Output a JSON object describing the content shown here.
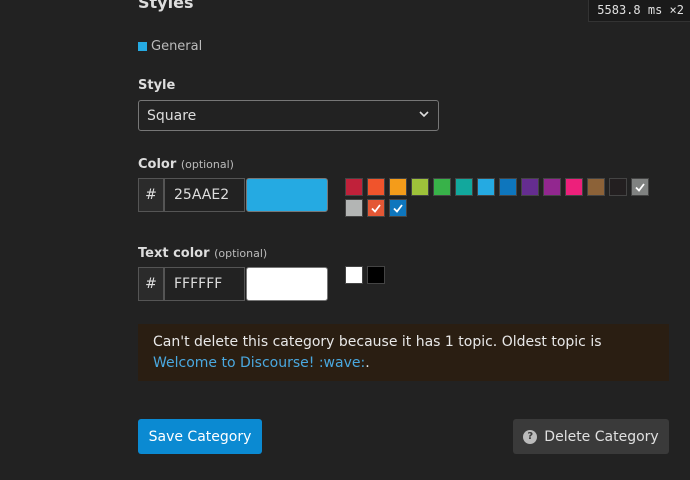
{
  "section_heading": "Styles",
  "timer": {
    "value": "5583.8",
    "unit": "ms",
    "multiplier": "×2"
  },
  "category_badge": {
    "name": "General",
    "color": "#25aae2"
  },
  "style": {
    "label": "Style",
    "selected": "Square"
  },
  "color": {
    "label": "Color",
    "optional": "(optional)",
    "hash": "#",
    "hex_value": "25AAE2",
    "preview_color": "#25aae2",
    "swatches": [
      {
        "color": "#c0213a",
        "checked": false
      },
      {
        "color": "#f0542c",
        "checked": false
      },
      {
        "color": "#f49c1a",
        "checked": false
      },
      {
        "color": "#9ec23a",
        "checked": false
      },
      {
        "color": "#38b249",
        "checked": false
      },
      {
        "color": "#12a89d",
        "checked": false
      },
      {
        "color": "#25aae2",
        "checked": false
      },
      {
        "color": "#0e76bd",
        "checked": false
      },
      {
        "color": "#652d90",
        "checked": false
      },
      {
        "color": "#92278f",
        "checked": false
      },
      {
        "color": "#ed207b",
        "checked": false
      },
      {
        "color": "#8c6238",
        "checked": false
      },
      {
        "color": "#231f20",
        "checked": false
      },
      {
        "color": "#808281",
        "checked": true
      },
      {
        "color": "#b3b5b4",
        "checked": false
      },
      {
        "color": "#e45735",
        "checked": true
      },
      {
        "color": "#0e76bd",
        "checked": true
      }
    ]
  },
  "text_color": {
    "label": "Text color",
    "optional": "(optional)",
    "hash": "#",
    "hex_value": "FFFFFF",
    "preview_color": "#ffffff",
    "swatches": [
      {
        "color": "#ffffff",
        "checked": false
      },
      {
        "color": "#000000",
        "checked": false
      }
    ]
  },
  "notice": {
    "text": "Can't delete this category because it has 1 topic. Oldest topic is",
    "link": "Welcome to Discourse! :wave:",
    "suffix": "."
  },
  "buttons": {
    "save": "Save Category",
    "delete": "Delete Category"
  }
}
